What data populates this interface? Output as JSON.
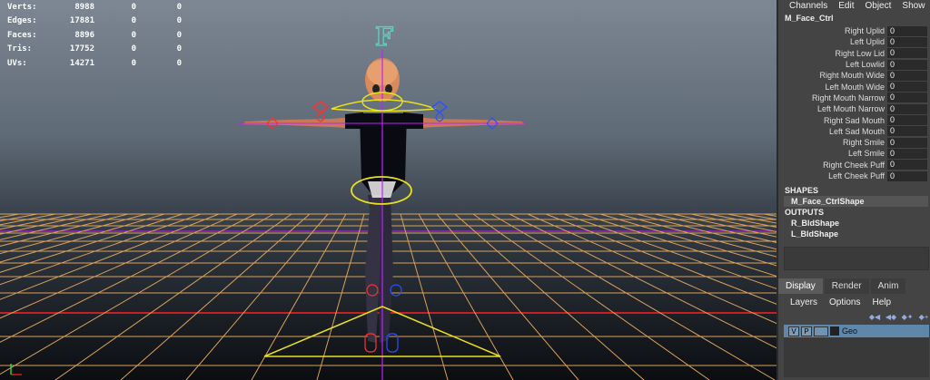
{
  "hud": {
    "rows": [
      {
        "label": "Verts:",
        "v1": "8988",
        "v2": "0",
        "v3": "0"
      },
      {
        "label": "Edges:",
        "v1": "17881",
        "v2": "0",
        "v3": "0"
      },
      {
        "label": "Faces:",
        "v1": "8896",
        "v2": "0",
        "v3": "0"
      },
      {
        "label": "Tris:",
        "v1": "17752",
        "v2": "0",
        "v3": "0"
      },
      {
        "label": "UVs:",
        "v1": "14271",
        "v2": "0",
        "v3": "0"
      }
    ]
  },
  "viewport": {
    "face_control_letter": "F"
  },
  "channel_box": {
    "menu": [
      "Channels",
      "Edit",
      "Object",
      "Show"
    ],
    "object_name": "M_Face_Ctrl",
    "channels": [
      {
        "label": "Right Uplid",
        "value": "0"
      },
      {
        "label": "Left Uplid",
        "value": "0"
      },
      {
        "label": "Right Low Lid",
        "value": "0"
      },
      {
        "label": "Left Lowlid",
        "value": "0"
      },
      {
        "label": "Right Mouth Wide",
        "value": "0"
      },
      {
        "label": "Left Mouth Wide",
        "value": "0"
      },
      {
        "label": "Right Mouth Narrow",
        "value": "0"
      },
      {
        "label": "Left Mouth Narrow",
        "value": "0"
      },
      {
        "label": "Right Sad Mouth",
        "value": "0"
      },
      {
        "label": "Left Sad Mouth",
        "value": "0"
      },
      {
        "label": "Right Smile",
        "value": "0"
      },
      {
        "label": "Left Smile",
        "value": "0"
      },
      {
        "label": "Right Cheek Puff",
        "value": "0"
      },
      {
        "label": "Left Cheek Puff",
        "value": "0"
      }
    ],
    "shapes_header": "SHAPES",
    "shape_item": "M_Face_CtrlShape",
    "outputs_header": "OUTPUTS",
    "outputs": [
      "R_BldShape",
      "L_BldShape"
    ]
  },
  "layer_editor": {
    "tabs": [
      "Display",
      "Render",
      "Anim"
    ],
    "active_tab": "Display",
    "menu": [
      "Layers",
      "Options",
      "Help"
    ],
    "layer": {
      "v": "V",
      "p": "P",
      "name": "Geo"
    }
  },
  "colors": {
    "grid": "#d9a15c",
    "axis_red": "#ff2020",
    "axis_magenta": "#c020ff",
    "face_ctrl": "#5fd0c0",
    "ctrl_yellow": "#e8e020",
    "selected_layer": "#5e87aa"
  }
}
